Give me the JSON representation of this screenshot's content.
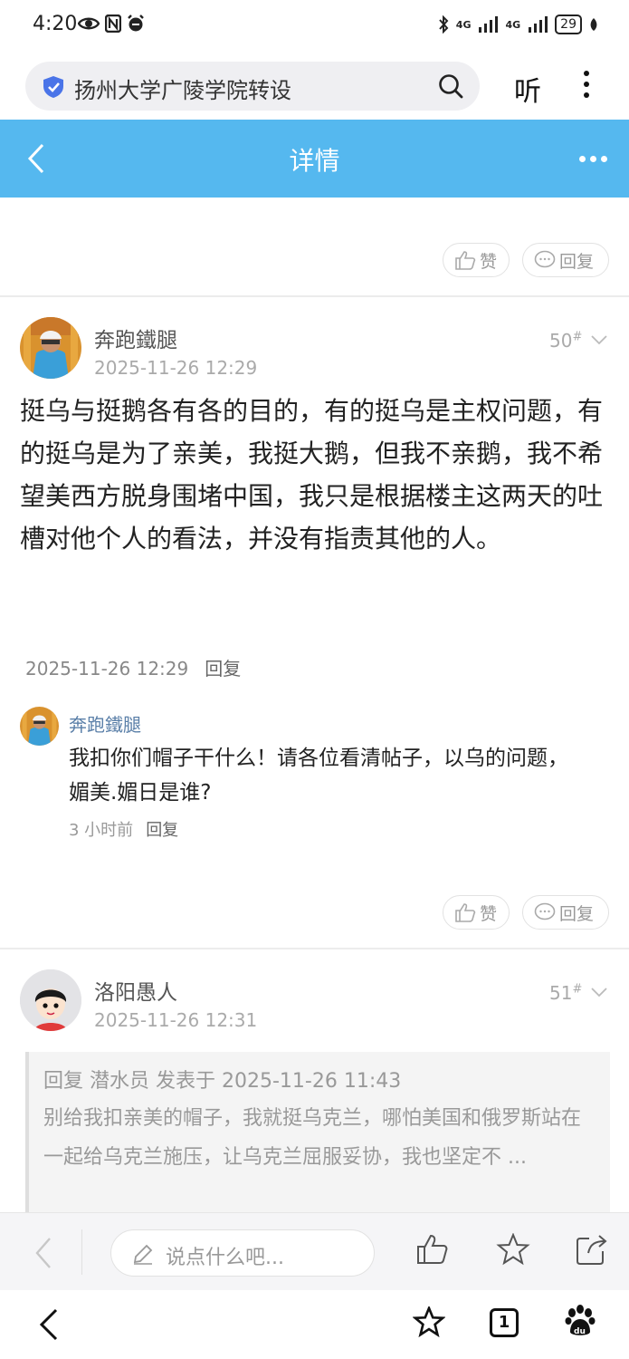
{
  "status_bar": {
    "time": "4:20",
    "network_1": "4G",
    "network_2": "4G",
    "battery": "29"
  },
  "browser": {
    "url_text": "扬州大学广陵学院转设",
    "listen_label": "听"
  },
  "header": {
    "title": "详情"
  },
  "top_actions": {
    "like_label": "赞",
    "reply_label": "回复"
  },
  "posts": [
    {
      "username": "奔跑鐵腿",
      "time": "2025-11-26 12:29",
      "floor": "50",
      "floor_mark": "#",
      "body": "挺乌与挺鹅各有各的目的，有的挺乌是主权问题，有的挺乌是为了亲美，我挺大鹅，但我不亲鹅，我不希望美西方脱身围堵中国，我只是根据楼主这两天的吐槽对他个人的看法，并没有指责其他的人。",
      "meta_time": "2025-11-26 12:29",
      "meta_reply": "回复",
      "sub_reply": {
        "username": "奔跑鐵腿",
        "text": "我扣你们帽子干什么！请各位看清帖子，以乌的问题，媚美.媚日是谁?",
        "time": "3 小时前",
        "reply": "回复"
      },
      "like_label": "赞",
      "reply_label": "回复"
    },
    {
      "username": "洛阳愚人",
      "time": "2025-11-26 12:31",
      "floor": "51",
      "floor_mark": "#",
      "quote_head": "回复 潜水员 发表于 2025-11-26 11:43",
      "quote_body": "别给我扣亲美的帽子，我就挺乌克兰，哪怕美国和俄罗斯站在一起给乌克兰施压，让乌克兰屈服妥协，我也坚定不 ..."
    }
  ],
  "comment_bar": {
    "placeholder": "说点什么吧..."
  },
  "navbar": {
    "tab_count": "1"
  },
  "colors": {
    "header_bg": "#55b8ef",
    "sub_name": "#5a7fa8"
  }
}
